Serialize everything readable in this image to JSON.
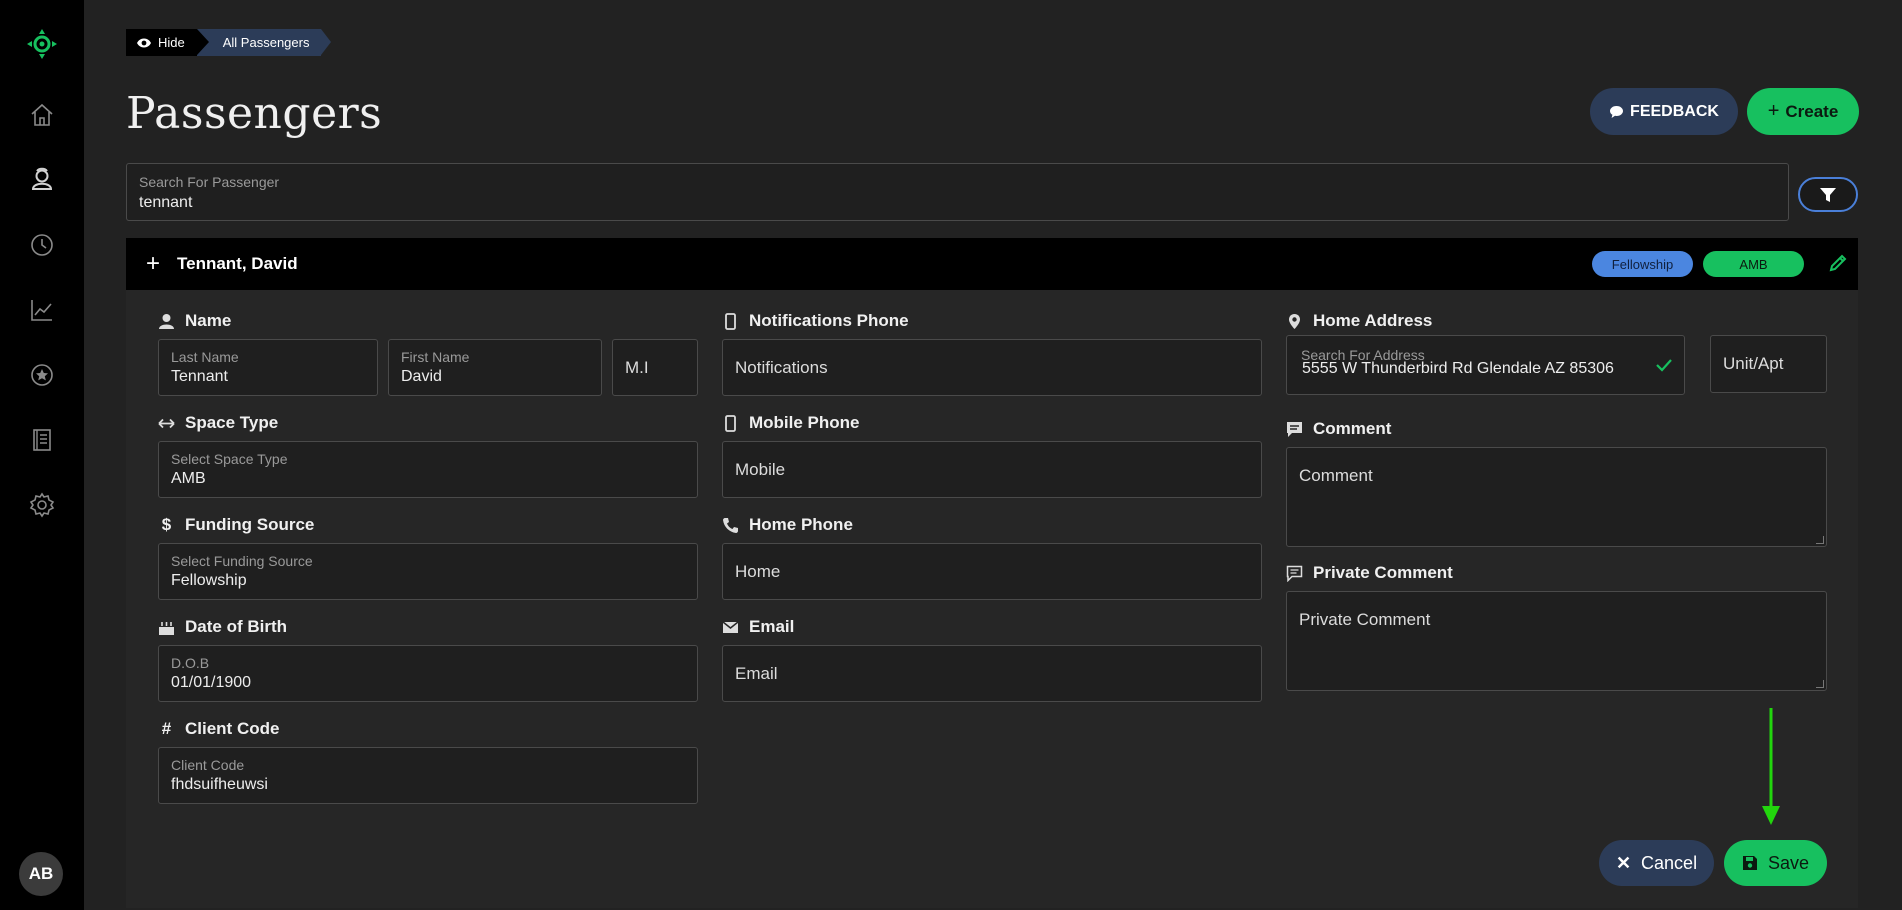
{
  "sidebar": {
    "items": [
      {
        "icon": "home-icon"
      },
      {
        "icon": "passenger-icon"
      },
      {
        "icon": "clock-icon"
      },
      {
        "icon": "chart-icon"
      },
      {
        "icon": "star-icon"
      },
      {
        "icon": "book-icon"
      },
      {
        "icon": "gear-icon"
      }
    ],
    "avatar_initials": "AB"
  },
  "breadcrumb": {
    "hide_label": "Hide",
    "current": "All Passengers"
  },
  "page": {
    "title": "Passengers"
  },
  "header_actions": {
    "feedback_label": "FEEDBACK",
    "create_label": "Create"
  },
  "search": {
    "label": "Search For Passenger",
    "value": "tennant"
  },
  "passenger": {
    "name": "Tennant, David",
    "funding_badge": "Fellowship",
    "space_badge": "AMB"
  },
  "form": {
    "name": {
      "section": "Name",
      "last_label": "Last Name",
      "last_value": "Tennant",
      "first_label": "First Name",
      "first_value": "David",
      "mi_placeholder": "M.I"
    },
    "space_type": {
      "section": "Space Type",
      "label": "Select Space Type",
      "value": "AMB"
    },
    "funding_source": {
      "section": "Funding Source",
      "label": "Select Funding Source",
      "value": "Fellowship"
    },
    "dob": {
      "section": "Date of Birth",
      "label": "D.O.B",
      "value": "01/01/1900"
    },
    "client_code": {
      "section": "Client Code",
      "label": "Client Code",
      "value": "fhdsuifheuwsi"
    },
    "notifications_phone": {
      "section": "Notifications Phone",
      "placeholder": "Notifications"
    },
    "mobile_phone": {
      "section": "Mobile Phone",
      "placeholder": "Mobile"
    },
    "home_phone": {
      "section": "Home Phone",
      "placeholder": "Home"
    },
    "email": {
      "section": "Email",
      "placeholder": "Email"
    },
    "home_address": {
      "section": "Home Address",
      "label": "Search For Address",
      "value": "5555 W Thunderbird Rd Glendale AZ 85306",
      "unit_placeholder": "Unit/Apt"
    },
    "comment": {
      "section": "Comment",
      "placeholder": "Comment"
    },
    "private_comment": {
      "section": "Private Comment",
      "placeholder": "Private Comment"
    }
  },
  "footer_actions": {
    "cancel_label": "Cancel",
    "save_label": "Save"
  },
  "colors": {
    "accent_green": "#17c05f",
    "navy": "#2c3c58",
    "blue": "#4b86e0",
    "arrow_green": "#22d60d"
  }
}
